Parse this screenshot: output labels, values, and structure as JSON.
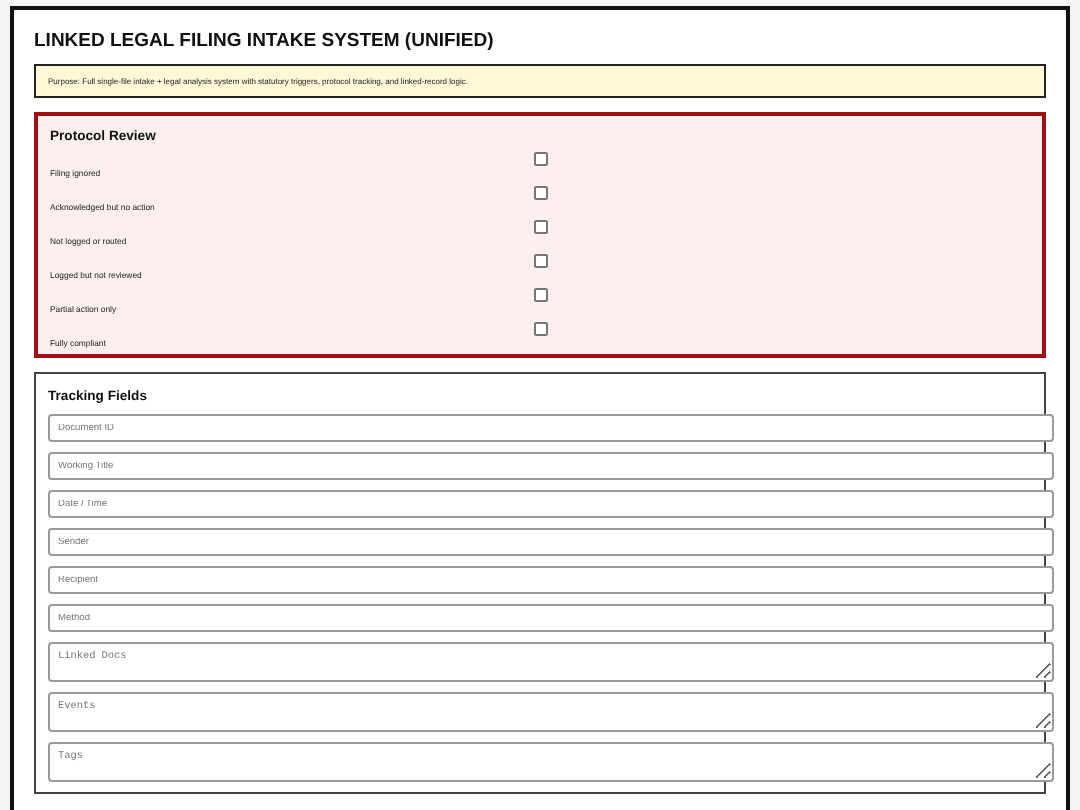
{
  "title": "LINKED LEGAL FILING INTAKE SYSTEM (UNIFIED)",
  "purpose": "Purpose: Full single-file intake + legal analysis system with statutory triggers, protocol tracking, and linked-record logic.",
  "protocol_review": {
    "heading": "Protocol Review",
    "items": [
      {
        "label": "Filing ignored",
        "checked": false
      },
      {
        "label": "Acknowledged but no action",
        "checked": false
      },
      {
        "label": "Not logged or routed",
        "checked": false
      },
      {
        "label": "Logged but not reviewed",
        "checked": false
      },
      {
        "label": "Partial action only",
        "checked": false
      },
      {
        "label": "Fully compliant",
        "checked": false
      }
    ]
  },
  "tracking_fields": {
    "heading": "Tracking Fields",
    "fields": [
      {
        "kind": "input",
        "placeholder": "Document ID"
      },
      {
        "kind": "input",
        "placeholder": "Working Title"
      },
      {
        "kind": "input",
        "placeholder": "Date / Time"
      },
      {
        "kind": "input",
        "placeholder": "Sender"
      },
      {
        "kind": "input",
        "placeholder": "Recipient"
      },
      {
        "kind": "input",
        "placeholder": "Method"
      },
      {
        "kind": "textarea",
        "placeholder": "Linked Docs"
      },
      {
        "kind": "textarea",
        "placeholder": "Events"
      },
      {
        "kind": "textarea",
        "placeholder": "Tags"
      }
    ]
  }
}
